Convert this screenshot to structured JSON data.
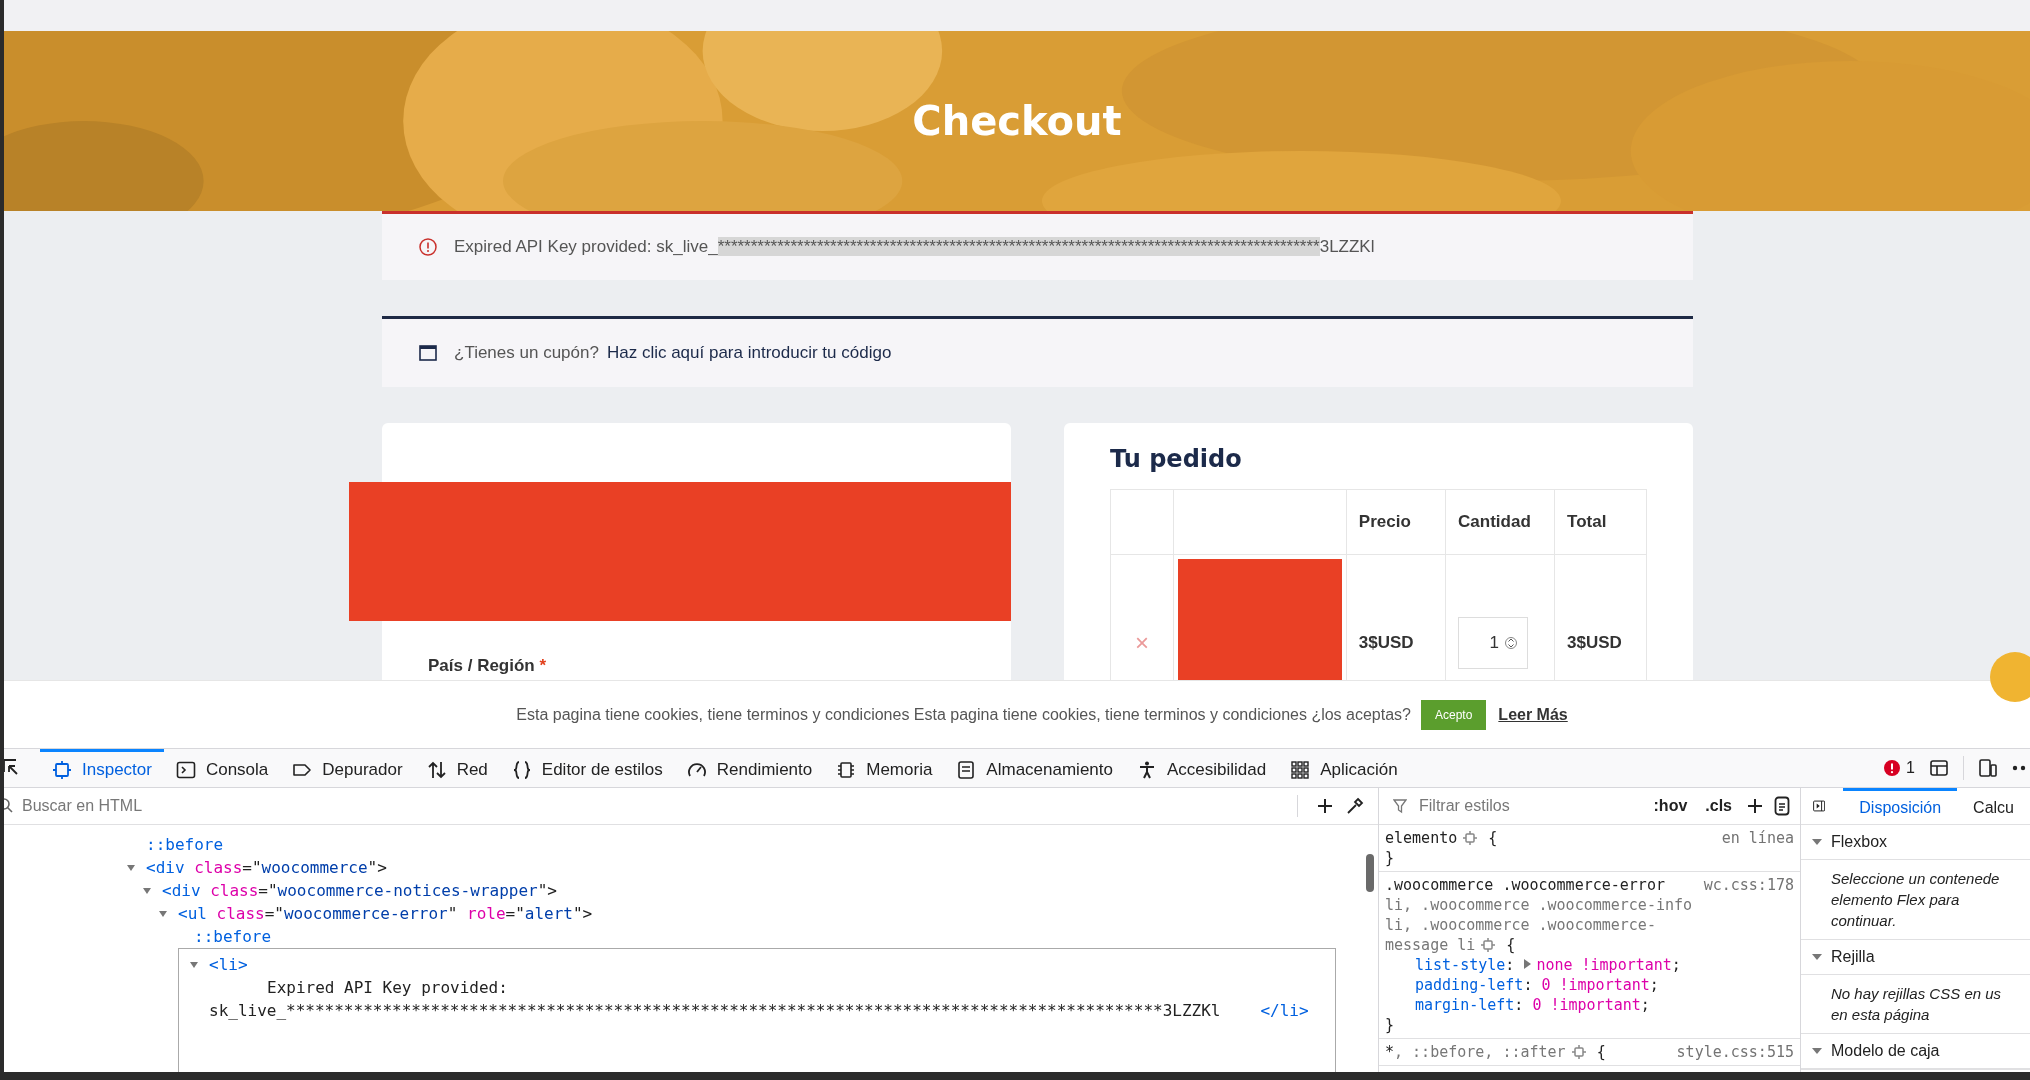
{
  "banner": {
    "title": "Checkout"
  },
  "error_notice": {
    "prefix": "Expired API Key provided: sk_live_",
    "highlighted": "*******************************************************************************************",
    "suffix": "3LZZKl"
  },
  "coupon_notice": {
    "text": "¿Tienes un cupón?",
    "link": "Haz clic aquí para introducir tu código"
  },
  "billing": {
    "field_label": "País / Región",
    "required_mark": "*"
  },
  "order": {
    "title": "Tu pedido",
    "columns": [
      "Precio",
      "Cantidad",
      "Total"
    ],
    "rows": [
      {
        "remove": "×",
        "price": "3$USD",
        "quantity": "1",
        "total": "3$USD"
      }
    ]
  },
  "cookie_bar": {
    "text": "Esta pagina tiene cookies, tiene terminos y condiciones Esta pagina tiene cookies, tiene terminos y condiciones ¿los aceptas?",
    "accept": "Acepto",
    "more": "Leer Más"
  },
  "devtools": {
    "tabs": [
      {
        "label": "Inspector",
        "selected": true
      },
      {
        "label": "Consola",
        "selected": false
      },
      {
        "label": "Depurador",
        "selected": false
      },
      {
        "label": "Red",
        "selected": false
      },
      {
        "label": "Editor de estilos",
        "selected": false
      },
      {
        "label": "Rendimiento",
        "selected": false
      },
      {
        "label": "Memoria",
        "selected": false
      },
      {
        "label": "Almacenamiento",
        "selected": false
      },
      {
        "label": "Accesibilidad",
        "selected": false
      },
      {
        "label": "Aplicación",
        "selected": false
      }
    ],
    "error_count": "1",
    "html_search": {
      "placeholder": "Buscar en HTML"
    },
    "html_tree": [
      {
        "kind": "pseudo",
        "text": "::before",
        "selected": false
      },
      {
        "kind": "element",
        "selected": false,
        "expanded": true,
        "lines": [
          {
            "indent": false,
            "tokens": [
              {
                "kind": "tag",
                "text": "<div"
              },
              {
                "kind": "attr",
                "text": " class"
              },
              {
                "kind": "punct",
                "text": "=\""
              },
              {
                "kind": "value",
                "text": "woocommerce"
              },
              {
                "kind": "punct",
                "text": "\">"
              }
            ]
          }
        ],
        "children": [
          {
            "kind": "element",
            "selected": false,
            "expanded": true,
            "lines": [
              {
                "indent": false,
                "tokens": [
                  {
                    "kind": "tag",
                    "text": "<div"
                  },
                  {
                    "kind": "attr",
                    "text": " class"
                  },
                  {
                    "kind": "punct",
                    "text": "=\""
                  },
                  {
                    "kind": "value",
                    "text": "woocommerce-notices-wrapper"
                  },
                  {
                    "kind": "punct",
                    "text": "\">"
                  }
                ]
              }
            ],
            "children": [
              {
                "kind": "element",
                "selected": false,
                "expanded": true,
                "lines": [
                  {
                    "indent": false,
                    "tokens": [
                      {
                        "kind": "tag",
                        "text": "<ul"
                      },
                      {
                        "kind": "attr",
                        "text": " class"
                      },
                      {
                        "kind": "punct",
                        "text": "=\""
                      },
                      {
                        "kind": "value",
                        "text": "woocommerce-error"
                      },
                      {
                        "kind": "punct",
                        "text": "\" "
                      },
                      {
                        "kind": "attr",
                        "text": "role"
                      },
                      {
                        "kind": "punct",
                        "text": "=\""
                      },
                      {
                        "kind": "value",
                        "text": "alert"
                      },
                      {
                        "kind": "punct",
                        "text": "\">"
                      }
                    ]
                  }
                ],
                "children": [
                  {
                    "kind": "pseudo",
                    "text": "::before",
                    "selected": false
                  },
                  {
                    "kind": "element",
                    "selected": true,
                    "expanded": true,
                    "lines": [
                      {
                        "indent": false,
                        "tokens": [
                          {
                            "kind": "tag",
                            "text": "<li>"
                          }
                        ]
                      },
                      {
                        "indent": true,
                        "tokens": [
                          {
                            "kind": "text",
                            "text": "Expired API Key provided:"
                          }
                        ]
                      },
                      {
                        "indent": false,
                        "tokens": [
                          {
                            "kind": "text",
                            "text": "sk_live_*******************************************************************************************3LZZKl"
                          },
                          {
                            "kind": "tag",
                            "text": "</li>"
                          }
                        ]
                      }
                    ]
                  }
                ]
              }
            ]
          }
        ]
      }
    ],
    "styles": {
      "filter_placeholder": "Filtrar estilos",
      "hov": ":hov",
      "cls": ".cls",
      "separator": ":",
      "terminator": ";",
      "rules": [
        {
          "selector": [
            {
              "text": "elemento",
              "matched": true
            }
          ],
          "gear": true,
          "open": "{",
          "source": "en línea",
          "close": "}"
        },
        {
          "selector": [
            {
              "text": ".woocommerce .woocommerce-error",
              "matched": true
            },
            {
              "text": " li, .woocommerce .woocommerce-info li, .woocommerce .woocommerce-message li",
              "matched": false
            }
          ],
          "gear": true,
          "open": "{",
          "source": "wc.css:178",
          "declarations": [
            {
              "property": "list-style",
              "value": "none !important",
              "expandable": true
            },
            {
              "property": "padding-left",
              "value": "0 !important",
              "expandable": false
            },
            {
              "property": "margin-left",
              "value": "0 !important",
              "expandable": false
            }
          ],
          "close": "}"
        },
        {
          "selector": [
            {
              "text": "*",
              "matched": true
            },
            {
              "text": ", ::before, ::after",
              "matched": false
            }
          ],
          "gear": true,
          "open": "{",
          "source": "style.css:515"
        }
      ]
    },
    "layout": {
      "tabs": [
        {
          "label": "Disposición",
          "selected": true
        },
        {
          "label": "Calcu",
          "selected": false
        }
      ],
      "sections": [
        {
          "title": "Flexbox",
          "expanded": true,
          "lines": [
            "Seleccione un contenede",
            "elemento Flex para",
            "continuar."
          ]
        },
        {
          "title": "Rejilla",
          "expanded": true,
          "lines": [
            "No hay rejillas CSS en us",
            "en esta página"
          ]
        },
        {
          "title": "Modelo de caja",
          "expanded": true
        }
      ]
    }
  }
}
